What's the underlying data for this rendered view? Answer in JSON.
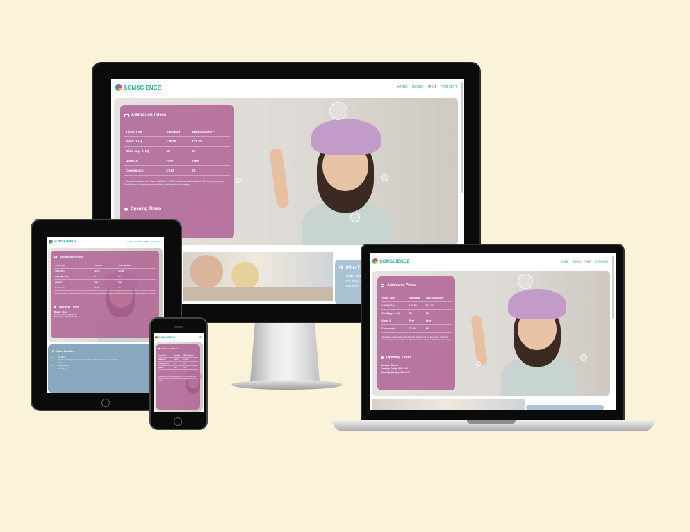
{
  "site": {
    "brand": "SOMSCIENCE",
    "nav": [
      "HOME",
      "INSIDE",
      "VISIT",
      "CONTACT"
    ],
    "admission_title": "Admission Prices",
    "table_headers": [
      "Ticket Type",
      "Standard",
      "With Donation*"
    ],
    "rows": [
      [
        "Adult (16+)",
        "£10.50",
        "£11.20"
      ],
      [
        "Child (age 3-15)",
        "£5",
        "£6"
      ],
      [
        "Under 3",
        "Free",
        "Free"
      ],
      [
        "Concession",
        "£7.50",
        "£8"
      ]
    ],
    "note": "* Donations allow us to claim Gift Aid on 100% of the admission ticket. All money helps our SomScience charity create exciting activities for all to enjoy",
    "opening_title": "Opening Times",
    "hours": [
      "Monday: Closed",
      "Tuesday-Friday: 9.00-5.00",
      "Saturday-Sunday: 9.00-5.00"
    ],
    "other_title": "Other Facilities",
    "other_items": [
      "Order Ahead",
      "For those wishing to take home a memento of their visit, the museum shop",
      "and more"
    ],
    "tablet_other_items": [
      "Gift Shop",
      "For those wishing to take home the health and health of the museum shop",
      "Cafe",
      "Baby Change",
      "Picnic Area"
    ]
  },
  "colors": {
    "background": "#faf3da",
    "panel": "#b06796",
    "accent": "#2aa896",
    "bluebox": "#a9c3d4"
  },
  "icons": {
    "ticket": "ticket-icon",
    "clock": "clock-icon",
    "info": "headset-icon",
    "logo": "balloon-logo-icon",
    "menu": "hamburger-menu-icon"
  }
}
